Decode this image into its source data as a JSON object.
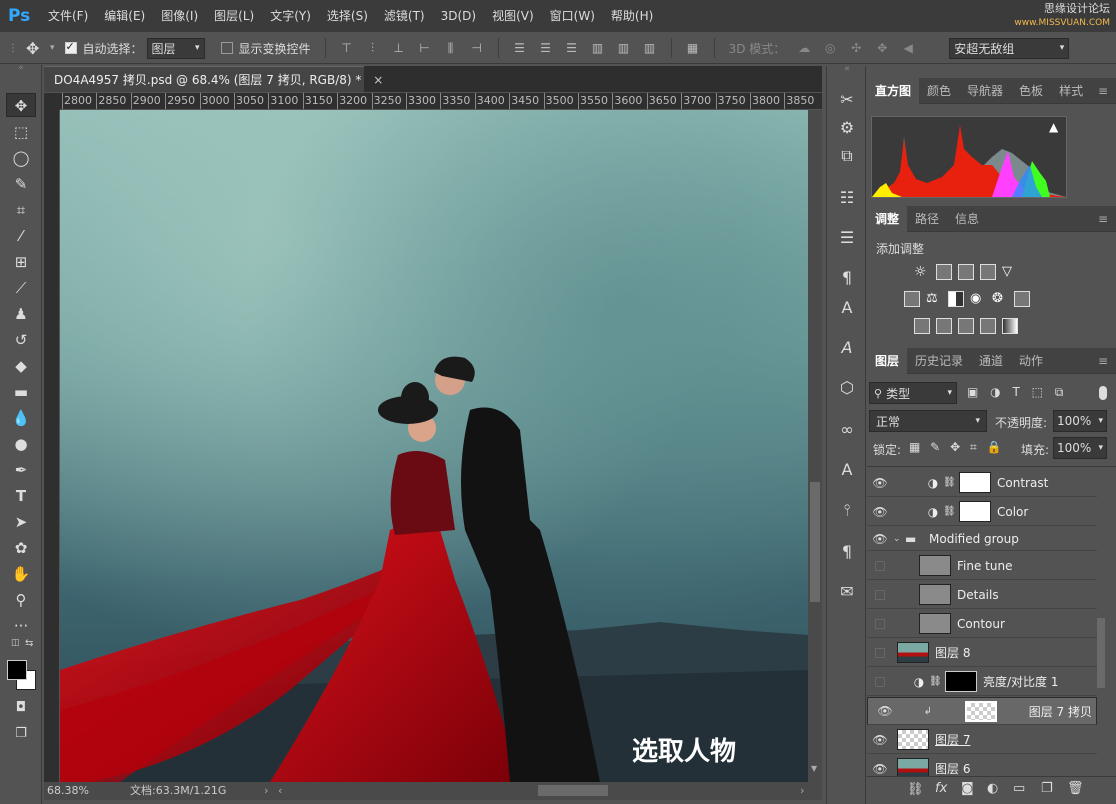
{
  "app": {
    "logo": "Ps"
  },
  "menu": [
    "文件(F)",
    "编辑(E)",
    "图像(I)",
    "图层(L)",
    "文字(Y)",
    "选择(S)",
    "滤镜(T)",
    "3D(D)",
    "视图(V)",
    "窗口(W)",
    "帮助(H)"
  ],
  "watermark": {
    "line1": "思缘设计论坛",
    "line2": "www.MISSVUAN.COM"
  },
  "options": {
    "auto_select_label": "自动选择：",
    "auto_select_value": "图层",
    "show_transform_label": "显示变换控件",
    "mode_3d_label": "3D 模式：",
    "workspace": "安超无敌组"
  },
  "document": {
    "tab_title": "DO4A4957 拷贝.psd @ 68.4% (图层 7 拷贝, RGB/8) *",
    "close": "×",
    "zoom": "68.38%",
    "doc_info": "文档:63.3M/1.21G",
    "overlay_text": "选取人物"
  },
  "ruler": [
    "2800",
    "2850",
    "2900",
    "2950",
    "3000",
    "3050",
    "3100",
    "3150",
    "3200",
    "3250",
    "3300",
    "3350",
    "3400",
    "3450",
    "3500",
    "3550",
    "3600",
    "3650",
    "3700",
    "3750",
    "3800",
    "3850"
  ],
  "histogram": {
    "tabs": [
      "直方图",
      "颜色",
      "导航器",
      "色板",
      "样式"
    ],
    "warning": "▲"
  },
  "adjustments": {
    "tabs": [
      "调整",
      "路径",
      "信息"
    ],
    "add_label": "添加调整"
  },
  "layers": {
    "tabs": [
      "图层",
      "历史记录",
      "通道",
      "动作"
    ],
    "filter_kind": "类型",
    "blend_mode": "正常",
    "opacity_label": "不透明度:",
    "opacity": "100%",
    "lock_label": "锁定:",
    "fill_label": "填充:",
    "fill": "100%",
    "rows": [
      {
        "name": "Contrast",
        "visible": true,
        "kind": "adjust-white"
      },
      {
        "name": "Color",
        "visible": true,
        "kind": "adjust-white"
      },
      {
        "name": "Modified group",
        "visible": true,
        "kind": "group"
      },
      {
        "name": "Fine tune",
        "visible": false,
        "kind": "gray"
      },
      {
        "name": "Details",
        "visible": false,
        "kind": "gray"
      },
      {
        "name": "Contour",
        "visible": false,
        "kind": "gray"
      },
      {
        "name": "图层 8",
        "visible": false,
        "kind": "photo"
      },
      {
        "name": "亮度/对比度 1",
        "visible": false,
        "kind": "adjust-black"
      },
      {
        "name": "图层 7 拷贝",
        "visible": true,
        "kind": "transparent",
        "selected": true
      },
      {
        "name": "图层 7",
        "visible": true,
        "kind": "transparent"
      },
      {
        "name": "图层 6",
        "visible": true,
        "kind": "photo"
      }
    ]
  }
}
